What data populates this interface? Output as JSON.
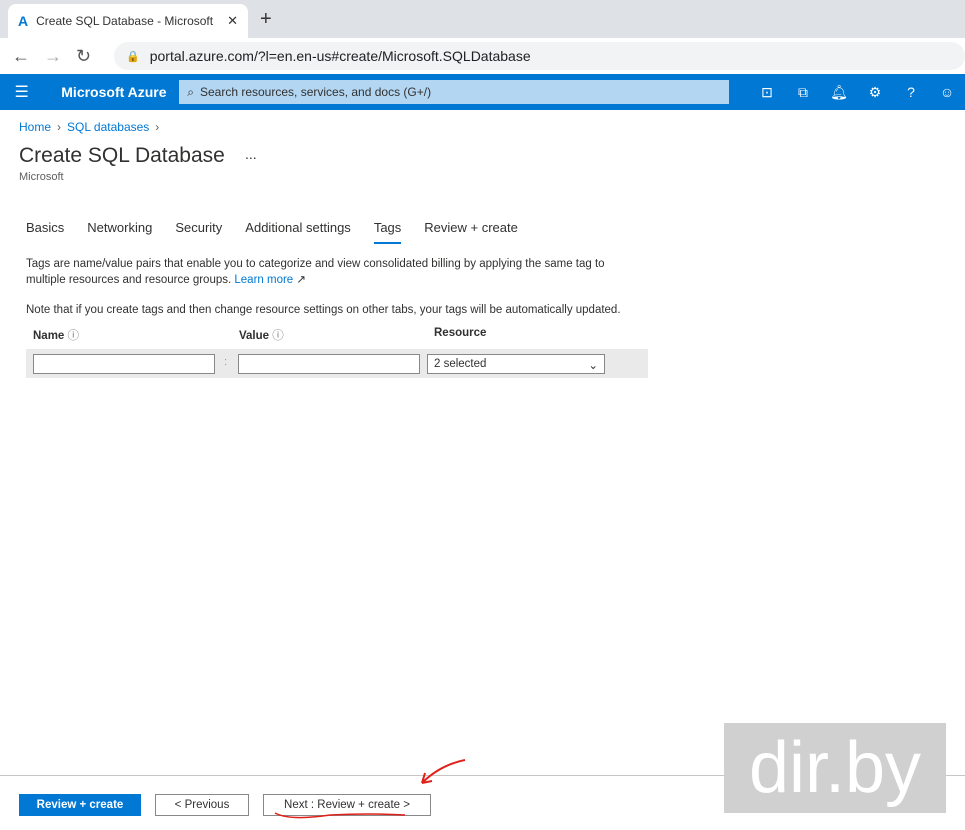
{
  "browser": {
    "tab_title": "Create SQL Database - Microsoft",
    "url": "portal.azure.com/?l=en.en-us#create/Microsoft.SQLDatabase"
  },
  "azure": {
    "brand": "Microsoft Azure",
    "search_placeholder": "Search resources, services, and docs (G+/)"
  },
  "breadcrumb": [
    "Home",
    "SQL databases"
  ],
  "page": {
    "title": "Create SQL Database",
    "subtitle": "Microsoft",
    "more": "..."
  },
  "tabs": [
    "Basics",
    "Networking",
    "Security",
    "Additional settings",
    "Tags",
    "Review + create"
  ],
  "active_tab": "Tags",
  "content": {
    "description": "Tags are name/value pairs that enable you to categorize and view consolidated billing by applying the same tag to multiple resources and resource groups.",
    "learn_more": "Learn more",
    "note": "Note that if you create tags and then change resource settings on other tabs, your tags will be automatically updated."
  },
  "table": {
    "headers": [
      "Name",
      "Value",
      "Resource"
    ],
    "row": {
      "name": "",
      "value": "",
      "separator": ":",
      "resource": "2 selected"
    }
  },
  "footer": {
    "review_create": "Review + create",
    "previous": "< Previous",
    "next": "Next : Review + create >"
  },
  "watermark": "dir.by"
}
